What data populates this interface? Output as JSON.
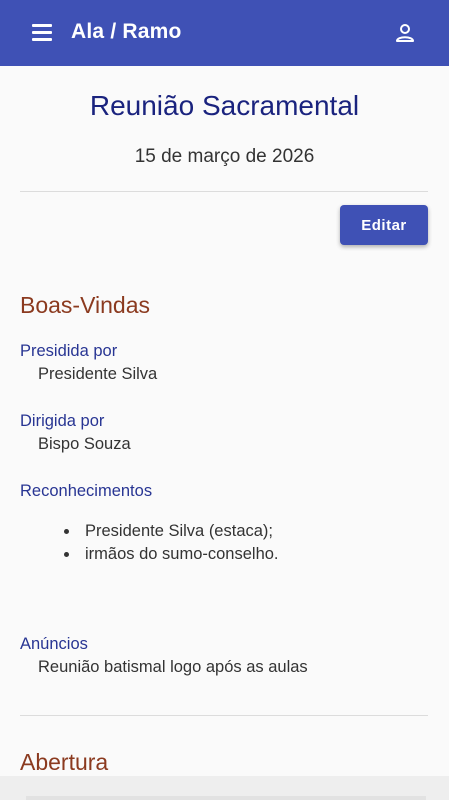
{
  "app_bar": {
    "title": "Ala / Ramo",
    "menu_icon": "menu-icon",
    "account_icon": "person-icon",
    "color": "#3f51b5"
  },
  "meeting": {
    "title": "Reunião Sacramental",
    "date": "15 de março de 2026",
    "edit_label": "Editar"
  },
  "sections": [
    {
      "title": "Boas-Vindas",
      "fields": [
        {
          "label": "Presidida por",
          "value": "Presidente Silva"
        },
        {
          "label": "Dirigida por",
          "value": "Bispo Souza"
        },
        {
          "label": "Reconhecimentos",
          "items": [
            "Presidente Silva (estaca);",
            "irmãos do sumo-conselho."
          ]
        },
        {
          "label": "Anúncios",
          "value": "Reunião batismal logo após as aulas"
        }
      ]
    },
    {
      "title": "Abertura"
    }
  ],
  "colors": {
    "primary": "#3f51b5",
    "section_title": "#8b3a1f",
    "label": "#283593"
  }
}
